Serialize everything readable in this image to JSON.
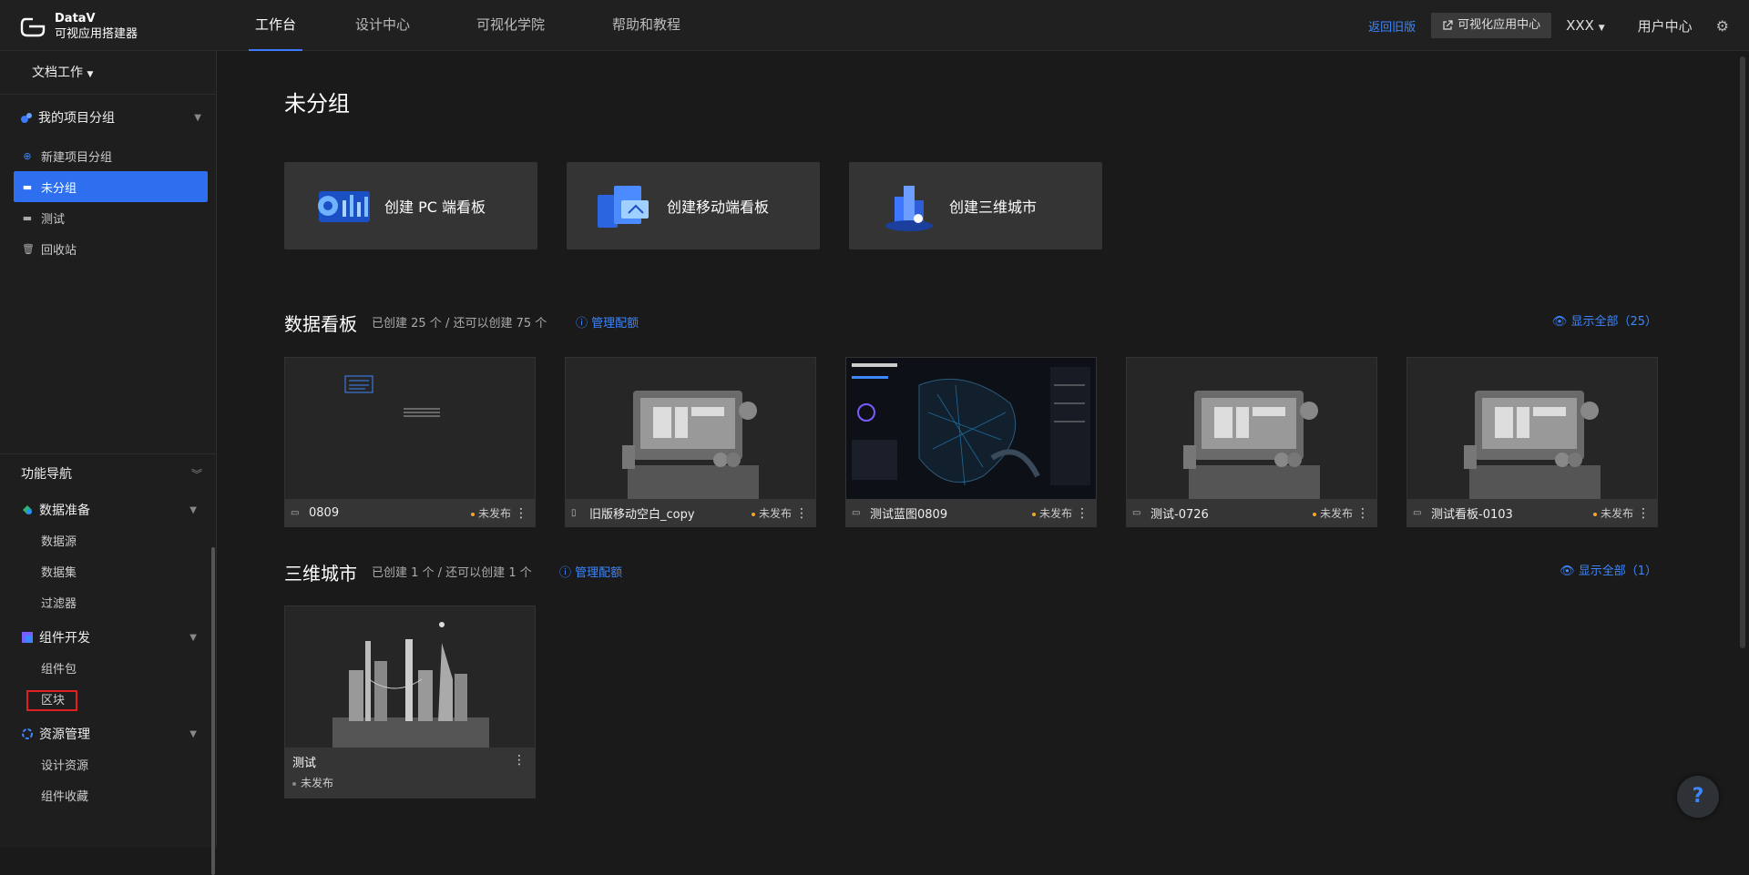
{
  "app": {
    "name": "DataV",
    "subtitle": "可视应用搭建器"
  },
  "nav": {
    "tabs": [
      "工作台",
      "设计中心",
      "可视化学院",
      "帮助和教程"
    ],
    "active": 0
  },
  "header": {
    "return_old": "返回旧版",
    "viz_center": "可视化应用中心",
    "user": "XXX",
    "user_center": "用户中心"
  },
  "sidebar": {
    "workspace": "文档工作",
    "group_title": "我的项目分组",
    "items": [
      {
        "label": "新建项目分组",
        "icon": "plus-circle-icon"
      },
      {
        "label": "未分组",
        "icon": "folder-icon",
        "active": true
      },
      {
        "label": "测试",
        "icon": "folder-icon"
      },
      {
        "label": "回收站",
        "icon": "trash-icon"
      }
    ],
    "func_nav": "功能导航",
    "sections": [
      {
        "title": "数据准备",
        "items": [
          "数据源",
          "数据集",
          "过滤器"
        ]
      },
      {
        "title": "组件开发",
        "items": [
          "组件包",
          "区块"
        ]
      },
      {
        "title": "资源管理",
        "items": [
          "设计资源",
          "组件收藏"
        ]
      }
    ]
  },
  "main": {
    "title": "未分组",
    "create_cards": [
      "创建 PC 端看板",
      "创建移动端看板",
      "创建三维城市"
    ],
    "dashboards": {
      "title": "数据看板",
      "info": "已创建 25 个 / 还可以创建 75 个",
      "manage": "管理配额",
      "show_all": "显示全部（25）",
      "items": [
        {
          "name": "0809",
          "status": "未发布"
        },
        {
          "name": "旧版移动空白_copy",
          "status": "未发布"
        },
        {
          "name": "测试蓝图0809",
          "status": "未发布"
        },
        {
          "name": "测试-0726",
          "status": "未发布"
        },
        {
          "name": "测试看板-0103",
          "status": "未发布"
        }
      ]
    },
    "city": {
      "title": "三维城市",
      "info": "已创建 1 个 / 还可以创建 1 个",
      "manage": "管理配额",
      "show_all": "显示全部（1）",
      "items": [
        {
          "name": "测试",
          "status": "未发布"
        }
      ]
    }
  },
  "help": "?"
}
